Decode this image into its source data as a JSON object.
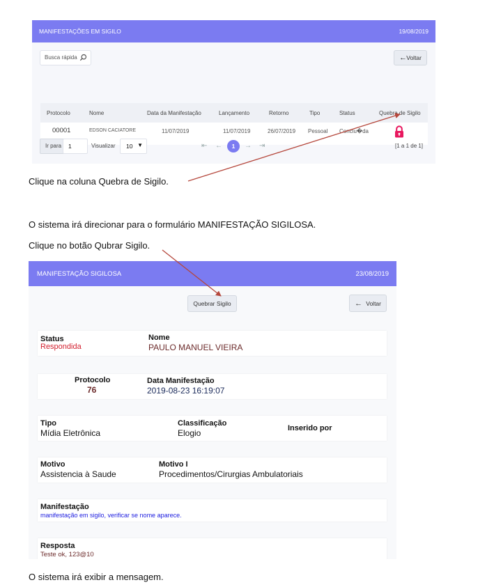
{
  "panel1": {
    "header_title": "MANIFESTAÇÕES EM SIGILO",
    "header_date": "19/08/2019",
    "search_placeholder": "Busca rápida",
    "back_label": "Voltar",
    "columns": [
      "Protocolo",
      "Nome",
      "Data da Manifestação",
      "Lançamento",
      "Retorno",
      "Tipo",
      "Status",
      "Quebra de Sigilo"
    ],
    "row": {
      "protocolo": "00001",
      "nome": "EDSON CACIATORE",
      "data": "11/07/2019",
      "lancamento": "11/07/2019",
      "retorno": "26/07/2019",
      "tipo": "Pessoal",
      "status": "Conclu�da"
    },
    "goto_label": "Ir para",
    "goto_value": "1",
    "view_label": "Visualizar",
    "page_size": "10",
    "current_page": "1",
    "range_text": "[1 a 1 de 1]"
  },
  "instructions": {
    "step1": "Clique na coluna Quebra de Sigilo.",
    "step2": "O sistema irá direcionar para o formulário MANIFESTAÇÃO SIGILOSA.",
    "step3": "Clique no botão Qubrar Sigilo.",
    "step4": "O sistema irá exibir a mensagem."
  },
  "panel2": {
    "header_title": "MANIFESTAÇÃO SIGILOSA",
    "header_date": "23/08/2019",
    "break_button": "Quebrar Sigilo",
    "back_label": "Voltar",
    "status_label": "Status",
    "status_value": "Respondida",
    "nome_label": "Nome",
    "nome_value": "PAULO MANUEL VIEIRA",
    "protocolo_label": "Protocolo",
    "protocolo_value": "76",
    "data_label": "Data Manifestação",
    "data_value": "2019-08-23 16:19:07",
    "tipo_label": "Tipo",
    "tipo_value": "Mídia Eletrônica",
    "classificacao_label": "Classificação",
    "classificacao_value": "Elogio",
    "inserido_label": "Inserido por",
    "motivo_label": "Motivo",
    "motivo_value": "Assistencia à Saude",
    "motivo1_label": "Motivo I",
    "motivo1_value": "Procedimentos/Cirurgias Ambulatoriais",
    "manifestacao_label": "Manifestação",
    "manifestacao_value": "manifestação em sigilo, verificar se nome aparece.",
    "resposta_label": "Resposta",
    "resposta_value": "Teste ok, 123@10"
  },
  "colors": {
    "header": "#7b7bf1",
    "lock": "#e8185f",
    "status_red": "#d21f2e",
    "arrow": "#b5473c",
    "link_blue": "#1a1adf"
  }
}
